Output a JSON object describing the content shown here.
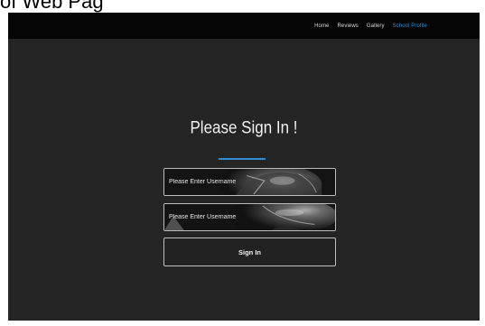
{
  "caption": "of Web Pag",
  "nav": {
    "items": [
      {
        "label": "Home",
        "active": false
      },
      {
        "label": "Reviews",
        "active": false
      },
      {
        "label": "Gallery",
        "active": false
      },
      {
        "label": "School Profile",
        "active": true
      }
    ]
  },
  "login": {
    "title": "Please Sign In !",
    "username_placeholder": "Please Enter Username",
    "password_placeholder": "Please Enter Username",
    "submit_label": "Sign In"
  },
  "colors": {
    "accent": "#2e8fd6",
    "background": "#252525",
    "navbar": "#050505"
  }
}
